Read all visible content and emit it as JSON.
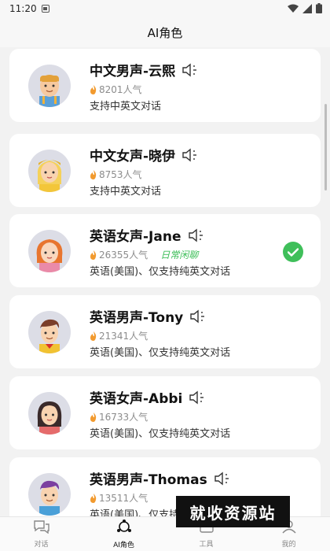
{
  "status_bar": {
    "time": "11:20"
  },
  "header": {
    "title": "AI角色"
  },
  "roles": [
    {
      "name": "中文男声-云熙",
      "popularity": "8201人气",
      "tag": "",
      "desc": "支持中英文对话",
      "selected": false,
      "avatar": "boy-blond-overalls"
    },
    {
      "name": "中文女声-晓伊",
      "popularity": "8753人气",
      "tag": "",
      "desc": "支持中英文对话",
      "selected": false,
      "avatar": "girl-blonde-cap"
    },
    {
      "name": "英语女声-Jane",
      "popularity": "26355人气",
      "tag": "日常闲聊",
      "desc": "英语(美国)、仅支持纯英文对话",
      "selected": true,
      "avatar": "girl-red-hair"
    },
    {
      "name": "英语男声-Tony",
      "popularity": "21341人气",
      "tag": "",
      "desc": "英语(美国)、仅支持纯英文对话",
      "selected": false,
      "avatar": "boy-brown-hair"
    },
    {
      "name": "英语女声-Abbi",
      "popularity": "16733人气",
      "tag": "",
      "desc": "英语(美国)、仅支持纯英文对话",
      "selected": false,
      "avatar": "girl-black-hair"
    },
    {
      "name": "英语男声-Thomas",
      "popularity": "13511人气",
      "tag": "",
      "desc": "英语(美国)、仅支持纯英文对话",
      "selected": false,
      "avatar": "boy-purple-hair"
    }
  ],
  "nav": [
    {
      "label": "对话",
      "icon": "chat-bubbles-icon",
      "active": false
    },
    {
      "label": "AI角色",
      "icon": "ai-role-icon",
      "active": true
    },
    {
      "label": "工具",
      "icon": "toolbox-icon",
      "active": false
    },
    {
      "label": "我的",
      "icon": "person-icon",
      "active": false
    }
  ],
  "watermark": {
    "text": "就收资源站"
  },
  "colors": {
    "accent_green": "#3fbf5a",
    "flame": "#f29a2e",
    "card_bg": "#ffffff",
    "page_bg": "#f2f2f2"
  }
}
